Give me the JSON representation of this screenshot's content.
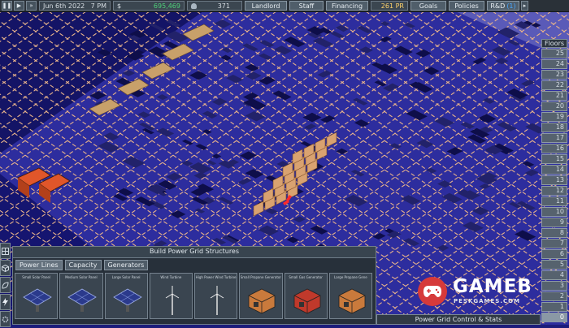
{
  "topbar": {
    "date": "Jun 6th 2022",
    "time": "7 PM",
    "currency_symbol": "$",
    "money": "695,469",
    "population": "371",
    "pr": "261 PR",
    "menus": [
      "Landlord",
      "Staff",
      "Financing",
      "Goals",
      "Policies",
      "R&D"
    ],
    "rd_count": "(1)"
  },
  "floors": {
    "title": "Floors",
    "levels": [
      "25",
      "24",
      "23",
      "22",
      "21",
      "20",
      "19",
      "18",
      "17",
      "16",
      "15",
      "14",
      "13",
      "12",
      "11",
      "10",
      "9",
      "8",
      "7",
      "6",
      "5",
      "4",
      "3",
      "2",
      "1",
      "0"
    ],
    "active": "0"
  },
  "build_panel": {
    "title": "Build Power Grid Structures",
    "tabs": [
      "Power Lines",
      "Capacity",
      "Generators"
    ],
    "items": [
      {
        "label": "Small Solar Panel",
        "icon": "solar-panel-small-icon"
      },
      {
        "label": "Medium Solar Panel",
        "icon": "solar-panel-medium-icon"
      },
      {
        "label": "Large Solar Panel",
        "icon": "solar-panel-large-icon"
      },
      {
        "label": "Wind Turbine",
        "icon": "wind-turbine-icon"
      },
      {
        "label": "High Power Wind Turbine",
        "icon": "wind-turbine-high-icon"
      },
      {
        "label": "Small Propane Generator",
        "icon": "propane-generator-small-icon"
      },
      {
        "label": "Small Gas Generator",
        "icon": "gas-generator-small-icon"
      },
      {
        "label": "Large Propane Gene",
        "icon": "propane-generator-large-icon"
      }
    ]
  },
  "power_grid_control": "Power Grid Control & Stats",
  "watermark": {
    "main": "GAMEB",
    "sub": "PESKGAMES.COM"
  },
  "colors": {
    "floor_tint": "#2d2d9e",
    "power_line": "#e8b38a",
    "solar_tile": "#d9a270",
    "generator": "#e0562a"
  }
}
